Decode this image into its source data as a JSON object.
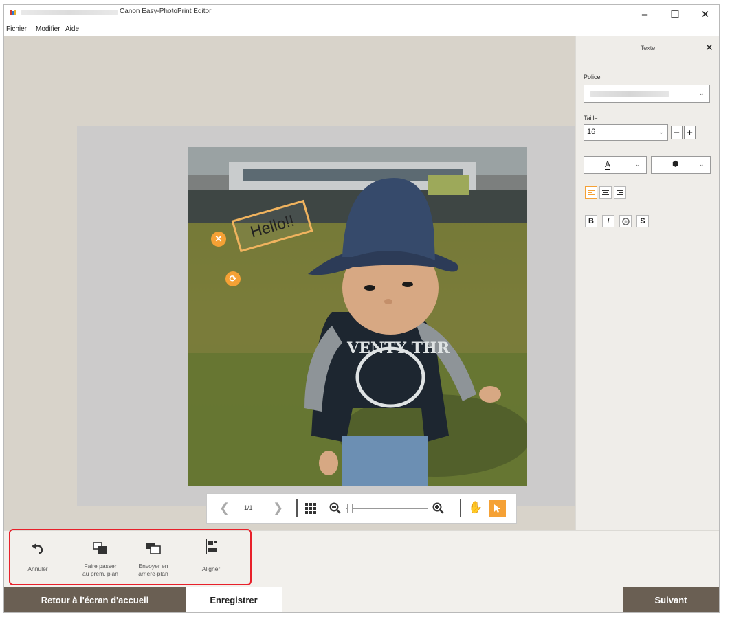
{
  "window": {
    "title": "Canon Easy-PhotoPrint Editor",
    "minimize": "–",
    "maximize": "☐",
    "close": "✕"
  },
  "menu": [
    "Fichier",
    "Modifier",
    "Aide"
  ],
  "canvas": {
    "text_item": "Hello!!"
  },
  "panel": {
    "title": "Texte",
    "close": "✕",
    "font_label": "Police",
    "size_label": "Taille",
    "size_value": "16",
    "minus": "−",
    "plus": "+",
    "color_letter": "A",
    "bold": "B",
    "italic": "I",
    "strike": "S"
  },
  "zoom": {
    "page_indicator": "1/1",
    "zoom_level": 0.02
  },
  "toolbar": {
    "undo": "Annuler",
    "bring_front": [
      "Faire passer",
      "au prem. plan"
    ],
    "send_back": [
      "Envoyer en",
      "arrière-plan"
    ],
    "align": "Aligner"
  },
  "footer": {
    "back": "Retour à l'écran d'accueil",
    "save": "Enregistrer",
    "next": "Suivant"
  },
  "colors": {
    "accent_orange": "#f5a135",
    "footer_dark": "#6a5f53",
    "highlight_red": "#e8202a"
  }
}
